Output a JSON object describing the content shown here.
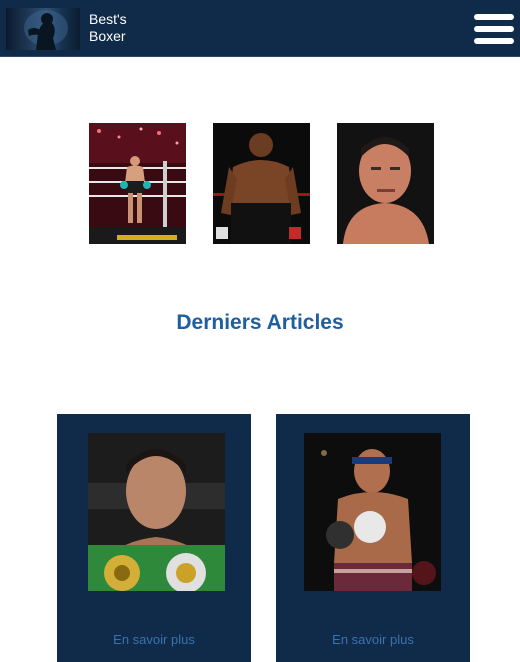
{
  "header": {
    "brand_line1": "Best's",
    "brand_line2": "Boxer",
    "logo_icon": "boxer-silhouette-logo",
    "menu_icon": "hamburger-menu-icon"
  },
  "gallery": {
    "items": [
      {
        "subject": "boxer-in-ring-photo"
      },
      {
        "subject": "heavyweight-boxer-portrait-photo"
      },
      {
        "subject": "fighter-headshot-photo"
      }
    ]
  },
  "articles": {
    "title": "Derniers Articles",
    "cards": [
      {
        "image": "champion-with-belts-photo",
        "link_label": "En savoir plus"
      },
      {
        "image": "muay-thai-fighter-photo",
        "link_label": "En savoir plus"
      }
    ]
  },
  "colors": {
    "header_bg": "#0f2b49",
    "card_bg": "#0f2b49",
    "title": "#1e5fa0",
    "link": "#3a72b0"
  }
}
